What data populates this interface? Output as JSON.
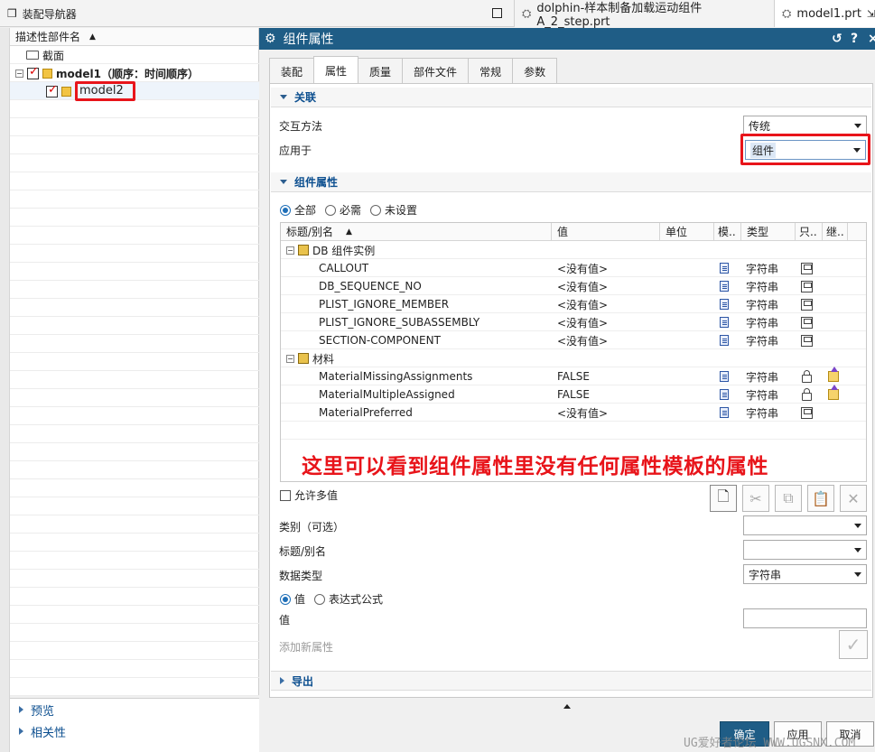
{
  "nav": {
    "title": "装配导航器",
    "column_header": "描述性部件名"
  },
  "tabs_top": [
    {
      "label": "dolphin-样本制备加载运动组件A_2_step.prt"
    },
    {
      "label": "model1.prt"
    }
  ],
  "tree": {
    "section": "截面",
    "model1": "model1（顺序：时间顺序）",
    "model2": "model2"
  },
  "left_bottom": {
    "preview": "预览",
    "dependencies": "相关性"
  },
  "dialog": {
    "title": "组件属性",
    "tabs": [
      "装配",
      "属性",
      "质量",
      "部件文件",
      "常规",
      "参数"
    ],
    "active_tab": "属性",
    "association": {
      "header": "关联",
      "interaction_label": "交互方法",
      "interaction_value": "传统",
      "apply_label": "应用于",
      "apply_value": "组件"
    },
    "component_props": {
      "header": "组件属性",
      "filters": [
        "全部",
        "必需",
        "未设置"
      ],
      "columns": [
        "标题/别名",
        "值",
        "单位",
        "模..",
        "类型",
        "只..",
        "继.."
      ],
      "groups": [
        {
          "name": "DB 组件实例",
          "rows": [
            {
              "title": "CALLOUT",
              "value": "<没有值>",
              "type": "字符串",
              "lock": "save"
            },
            {
              "title": "DB_SEQUENCE_NO",
              "value": "<没有值>",
              "type": "字符串",
              "lock": "save"
            },
            {
              "title": "PLIST_IGNORE_MEMBER",
              "value": "<没有值>",
              "type": "字符串",
              "lock": "save"
            },
            {
              "title": "PLIST_IGNORE_SUBASSEMBLY",
              "value": "<没有值>",
              "type": "字符串",
              "lock": "save"
            },
            {
              "title": "SECTION-COMPONENT",
              "value": "<没有值>",
              "type": "字符串",
              "lock": "save"
            }
          ]
        },
        {
          "name": "材料",
          "rows": [
            {
              "title": "MaterialMissingAssignments",
              "value": "FALSE",
              "type": "字符串",
              "lock": "lock",
              "inherit": true
            },
            {
              "title": "MaterialMultipleAssigned",
              "value": "FALSE",
              "type": "字符串",
              "lock": "lock",
              "inherit": true
            },
            {
              "title": "MaterialPreferred",
              "value": "<没有值>",
              "type": "字符串",
              "lock": "save"
            }
          ]
        }
      ],
      "annotation": "这里可以看到组件属性里没有任何属性模板的属性"
    },
    "form": {
      "allow_multi": "允许多值",
      "category_label": "类别（可选）",
      "title_label": "标题/别名",
      "datatype_label": "数据类型",
      "datatype_value": "字符串",
      "value_modes": [
        "值",
        "表达式公式"
      ],
      "value_label": "值",
      "add_new": "添加新属性"
    },
    "export": {
      "header": "导出"
    },
    "buttons": {
      "ok": "确定",
      "apply": "应用",
      "cancel": "取消"
    }
  },
  "watermark": "UG爱好者论坛 WWW.UGSNX.COM",
  "colors": {
    "title_bar": "#1f5d86",
    "annotation": "#e8141a",
    "section_header": "#0b4e8f"
  }
}
